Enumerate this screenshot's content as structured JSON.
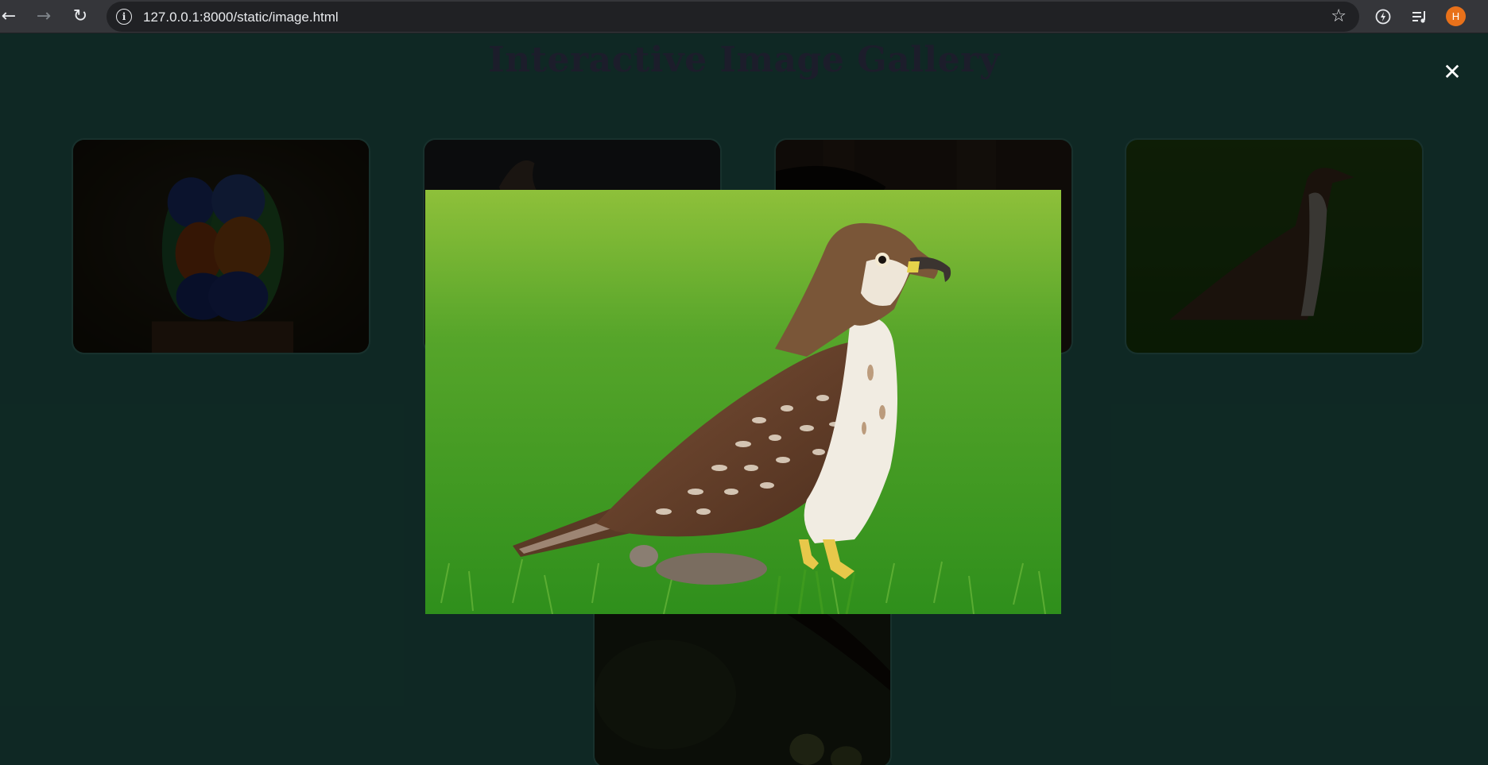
{
  "browser": {
    "url": "127.0.0.1:8000/static/image.html",
    "profile_initial": "H",
    "icons": {
      "back": "back-arrow-icon",
      "forward": "forward-arrow-icon",
      "reload": "reload-icon",
      "site_info": "info-icon",
      "bookmark": "star-icon",
      "extension": "extension-icon",
      "media": "media-queue-icon"
    }
  },
  "gallery": {
    "title": "Interactive Image Gallery",
    "thumbnails": [
      {
        "subject": "rainbow lorikeets on a post"
      },
      {
        "subject": "bird of prey"
      },
      {
        "subject": "bird on dark background"
      },
      {
        "subject": "red-tailed hawk on grass"
      },
      {
        "subject": "branch with fruit"
      }
    ]
  },
  "modal": {
    "close_label": "✕",
    "image_subject": "red-tailed hawk standing on grass"
  },
  "colors": {
    "page_background": "#1c4a42",
    "title_color": "#33364f",
    "avatar": "#e8711a"
  }
}
